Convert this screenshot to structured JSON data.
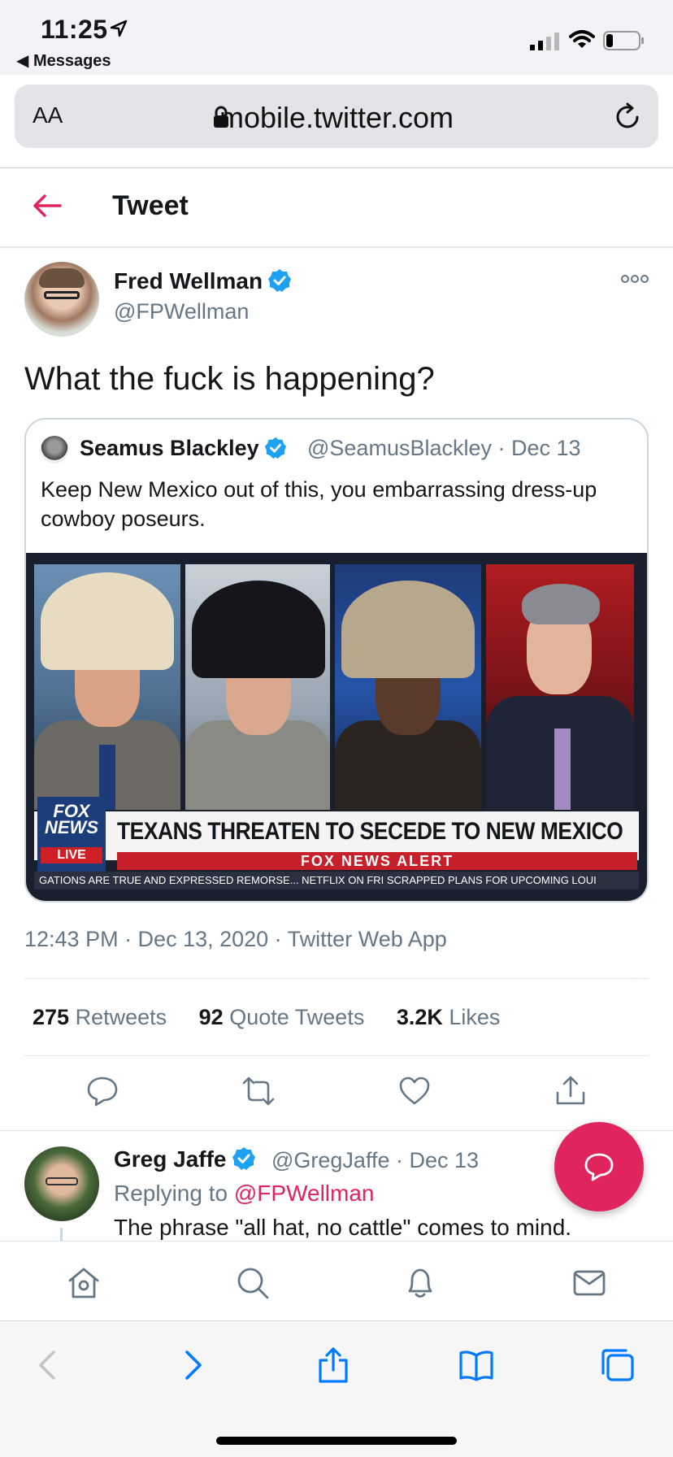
{
  "status_bar": {
    "time": "11:25",
    "back_app": "◀ Messages"
  },
  "url_bar": {
    "text_size": "AA",
    "url": "mobile.twitter.com"
  },
  "header": {
    "title": "Tweet"
  },
  "tweet": {
    "author_name": "Fred Wellman",
    "author_handle": "@FPWellman",
    "text": "What the fuck is happening?",
    "timestamp": "12:43 PM · Dec 13, 2020 · Twitter Web App",
    "stats": {
      "retweets_count": "275",
      "retweets_label": "Retweets",
      "quotes_count": "92",
      "quotes_label": "Quote Tweets",
      "likes_count": "3.2K",
      "likes_label": "Likes"
    }
  },
  "quoted": {
    "author_name": "Seamus Blackley",
    "meta": "@SeamusBlackley · Dec 13",
    "text": "Keep New Mexico out of this, you embarrassing dress-up cowboy poseurs.",
    "media": {
      "logo_text": "FOX NEWS",
      "live_label": "LIVE",
      "headline": "TEXANS THREATEN TO SECEDE TO NEW MEXICO",
      "alert": "FOX NEWS ALERT",
      "ticker": "GATIONS ARE TRUE AND EXPRESSED REMORSE...   NETFLIX ON FRI SCRAPPED PLANS FOR UPCOMING LOUI"
    }
  },
  "reply": {
    "author_name": "Greg Jaffe",
    "meta": "@GregJaffe · Dec 13",
    "replying_prefix": "Replying to ",
    "replying_to": "@FPWellman",
    "text": "The phrase \"all hat, no cattle\" comes to mind."
  },
  "colors": {
    "accent": "#e0245e",
    "verified": "#1da1f2",
    "secondary_text": "#657786",
    "safari_blue": "#007aff"
  },
  "icons": {
    "tweet_actions": [
      "reply-icon",
      "retweet-icon",
      "like-icon",
      "share-icon"
    ],
    "twitter_nav": [
      "home-icon",
      "search-icon",
      "notifications-icon",
      "messages-icon"
    ],
    "safari_toolbar": [
      "back-icon",
      "forward-icon",
      "share-icon",
      "bookmarks-icon",
      "tabs-icon"
    ]
  }
}
